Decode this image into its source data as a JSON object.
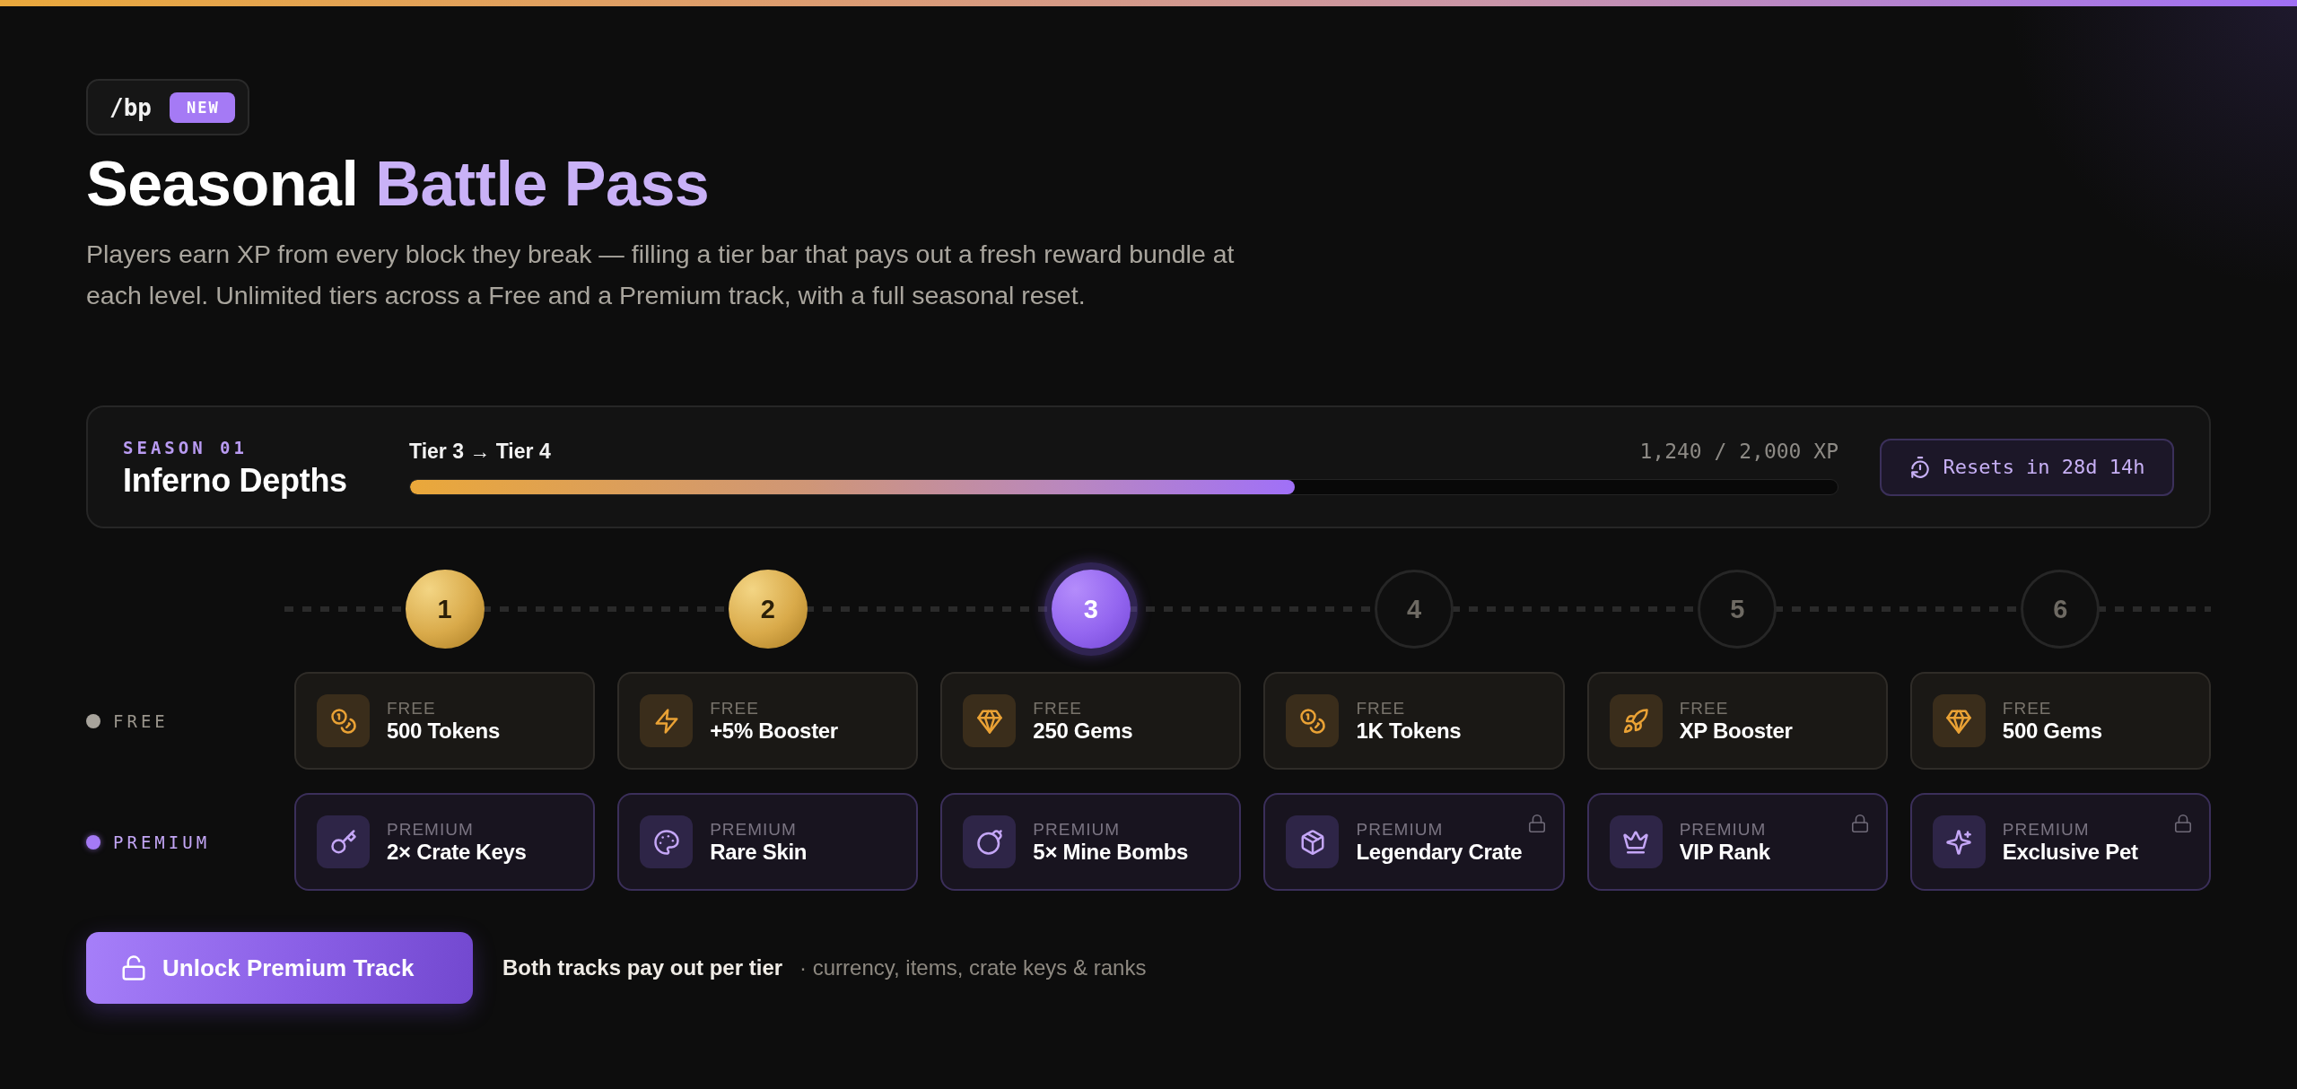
{
  "top_badge": {
    "command": "/bp",
    "tag": "NEW"
  },
  "title": {
    "lead": "Seasonal",
    "accent": "Battle Pass"
  },
  "description": "Players earn XP from every block they break — filling a tier bar that pays out a fresh reward bundle at each level. Unlimited tiers across a Free and a Premium track, with a full seasonal reset.",
  "season": {
    "label": "SEASON 01",
    "name": "Inferno Depths",
    "progress_label": "Tier 3 → Tier 4",
    "xp": "1,240 / 2,000 XP",
    "level": 0.62,
    "reset_button": "Resets in 28d 14h"
  },
  "tiers": [
    {
      "number": "1",
      "claimed": true,
      "current": false
    },
    {
      "number": "2",
      "claimed": true,
      "current": false
    },
    {
      "number": "3",
      "claimed": false,
      "current": true
    },
    {
      "number": "4",
      "claimed": false,
      "current": false
    },
    {
      "number": "5",
      "claimed": false,
      "current": false
    },
    {
      "number": "6",
      "claimed": false,
      "current": false
    }
  ],
  "tracks": [
    {
      "kind": "free",
      "label": "FREE",
      "color": "#a8a49c",
      "rewards": [
        {
          "kind": "tokens",
          "tag": "FREE",
          "name": "500 Tokens"
        },
        {
          "kind": "boost",
          "tag": "FREE",
          "name": "+5% Booster"
        },
        {
          "kind": "gems",
          "tag": "FREE",
          "name": "250 Gems"
        },
        {
          "kind": "tokens",
          "tag": "FREE",
          "name": "1K Tokens"
        },
        {
          "kind": "xp_boost",
          "tag": "FREE",
          "name": "XP Booster"
        },
        {
          "kind": "gems",
          "tag": "FREE",
          "name": "500 Gems"
        }
      ]
    },
    {
      "kind": "premium",
      "label": "PREMIUM",
      "color": "#a57af5",
      "rewards": [
        {
          "kind": "keys",
          "tag": "PREMIUM",
          "name": "2× Crate Keys",
          "locked": false
        },
        {
          "kind": "skin",
          "tag": "PREMIUM",
          "name": "Rare Skin",
          "locked": false
        },
        {
          "kind": "bombs",
          "tag": "PREMIUM",
          "name": "5× Mine Bombs",
          "locked": false
        },
        {
          "kind": "crate",
          "tag": "PREMIUM",
          "name": "Legendary Crate",
          "locked": true
        },
        {
          "kind": "rank",
          "tag": "PREMIUM",
          "name": "VIP Rank",
          "locked": true
        },
        {
          "kind": "pet",
          "tag": "PREMIUM",
          "name": "Exclusive Pet",
          "locked": true
        }
      ]
    }
  ],
  "unlock_button": "Unlock Premium Track",
  "footnote": {
    "heading": "Both tracks pay out per tier",
    "detail": "· currency, items, crate keys & ranks"
  }
}
